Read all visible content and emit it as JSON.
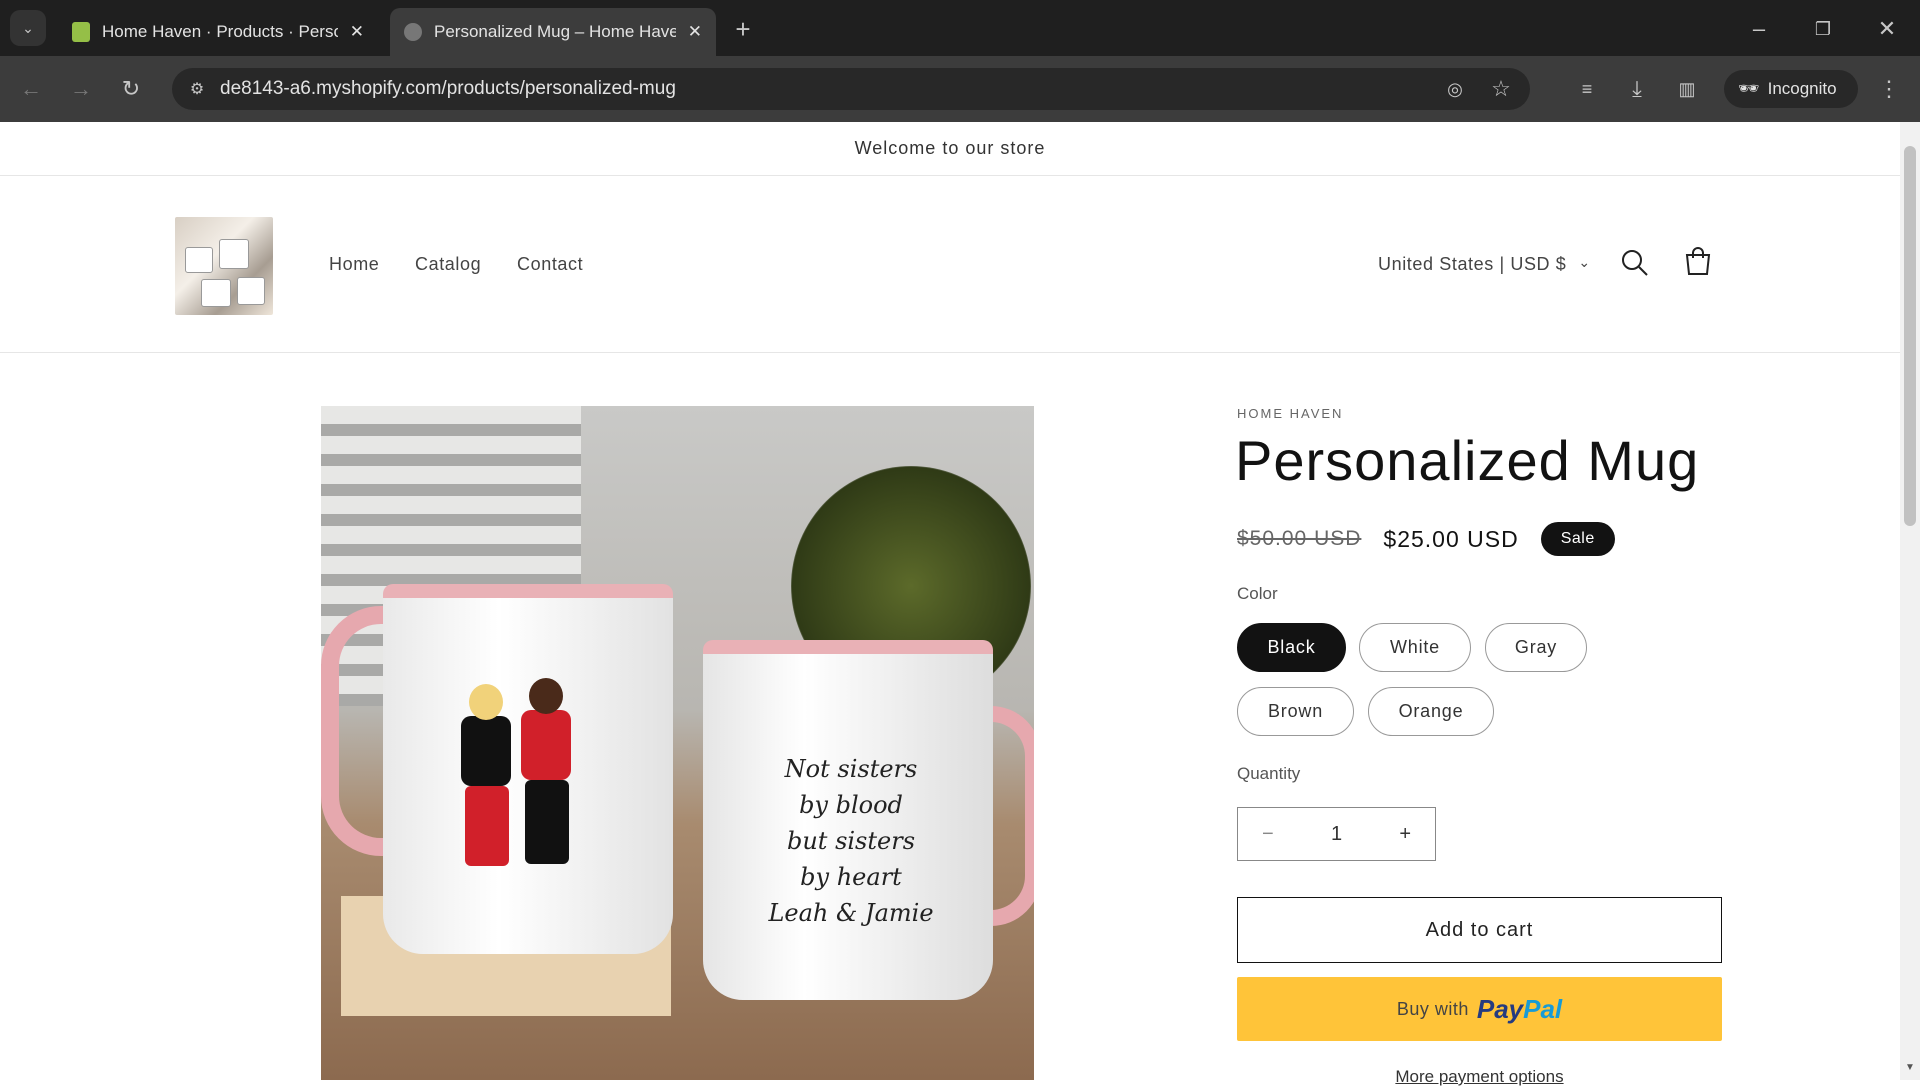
{
  "browser": {
    "tabs": [
      {
        "title": "Home Haven · Products · Personalized Mug",
        "active": false
      },
      {
        "title": "Personalized Mug – Home Haven",
        "active": true
      }
    ],
    "url": "de8143-a6.myshopify.com/products/personalized-mug",
    "profile": "Incognito"
  },
  "store": {
    "announcement": "Welcome to our store",
    "nav": [
      "Home",
      "Catalog",
      "Contact"
    ],
    "country": "United States | USD $"
  },
  "product": {
    "vendor": "HOME HAVEN",
    "title": "Personalized Mug",
    "compare_price": "$50.00 USD",
    "price": "$25.00 USD",
    "badge": "Sale",
    "color_label": "Color",
    "colors": [
      "Black",
      "White",
      "Gray",
      "Brown",
      "Orange"
    ],
    "selected_color": "Black",
    "quantity_label": "Quantity",
    "quantity": "1",
    "add_to_cart": "Add to cart",
    "buy_with": "Buy with",
    "paypal_pay": "Pay",
    "paypal_pal": "Pal",
    "more_options": "More payment options",
    "image_text": [
      "Not sisters",
      "by blood",
      "but sisters",
      "by heart",
      "Leah & Jamie"
    ]
  },
  "colors": {
    "paypal_yellow": "#ffc439",
    "badge": "#121212"
  }
}
